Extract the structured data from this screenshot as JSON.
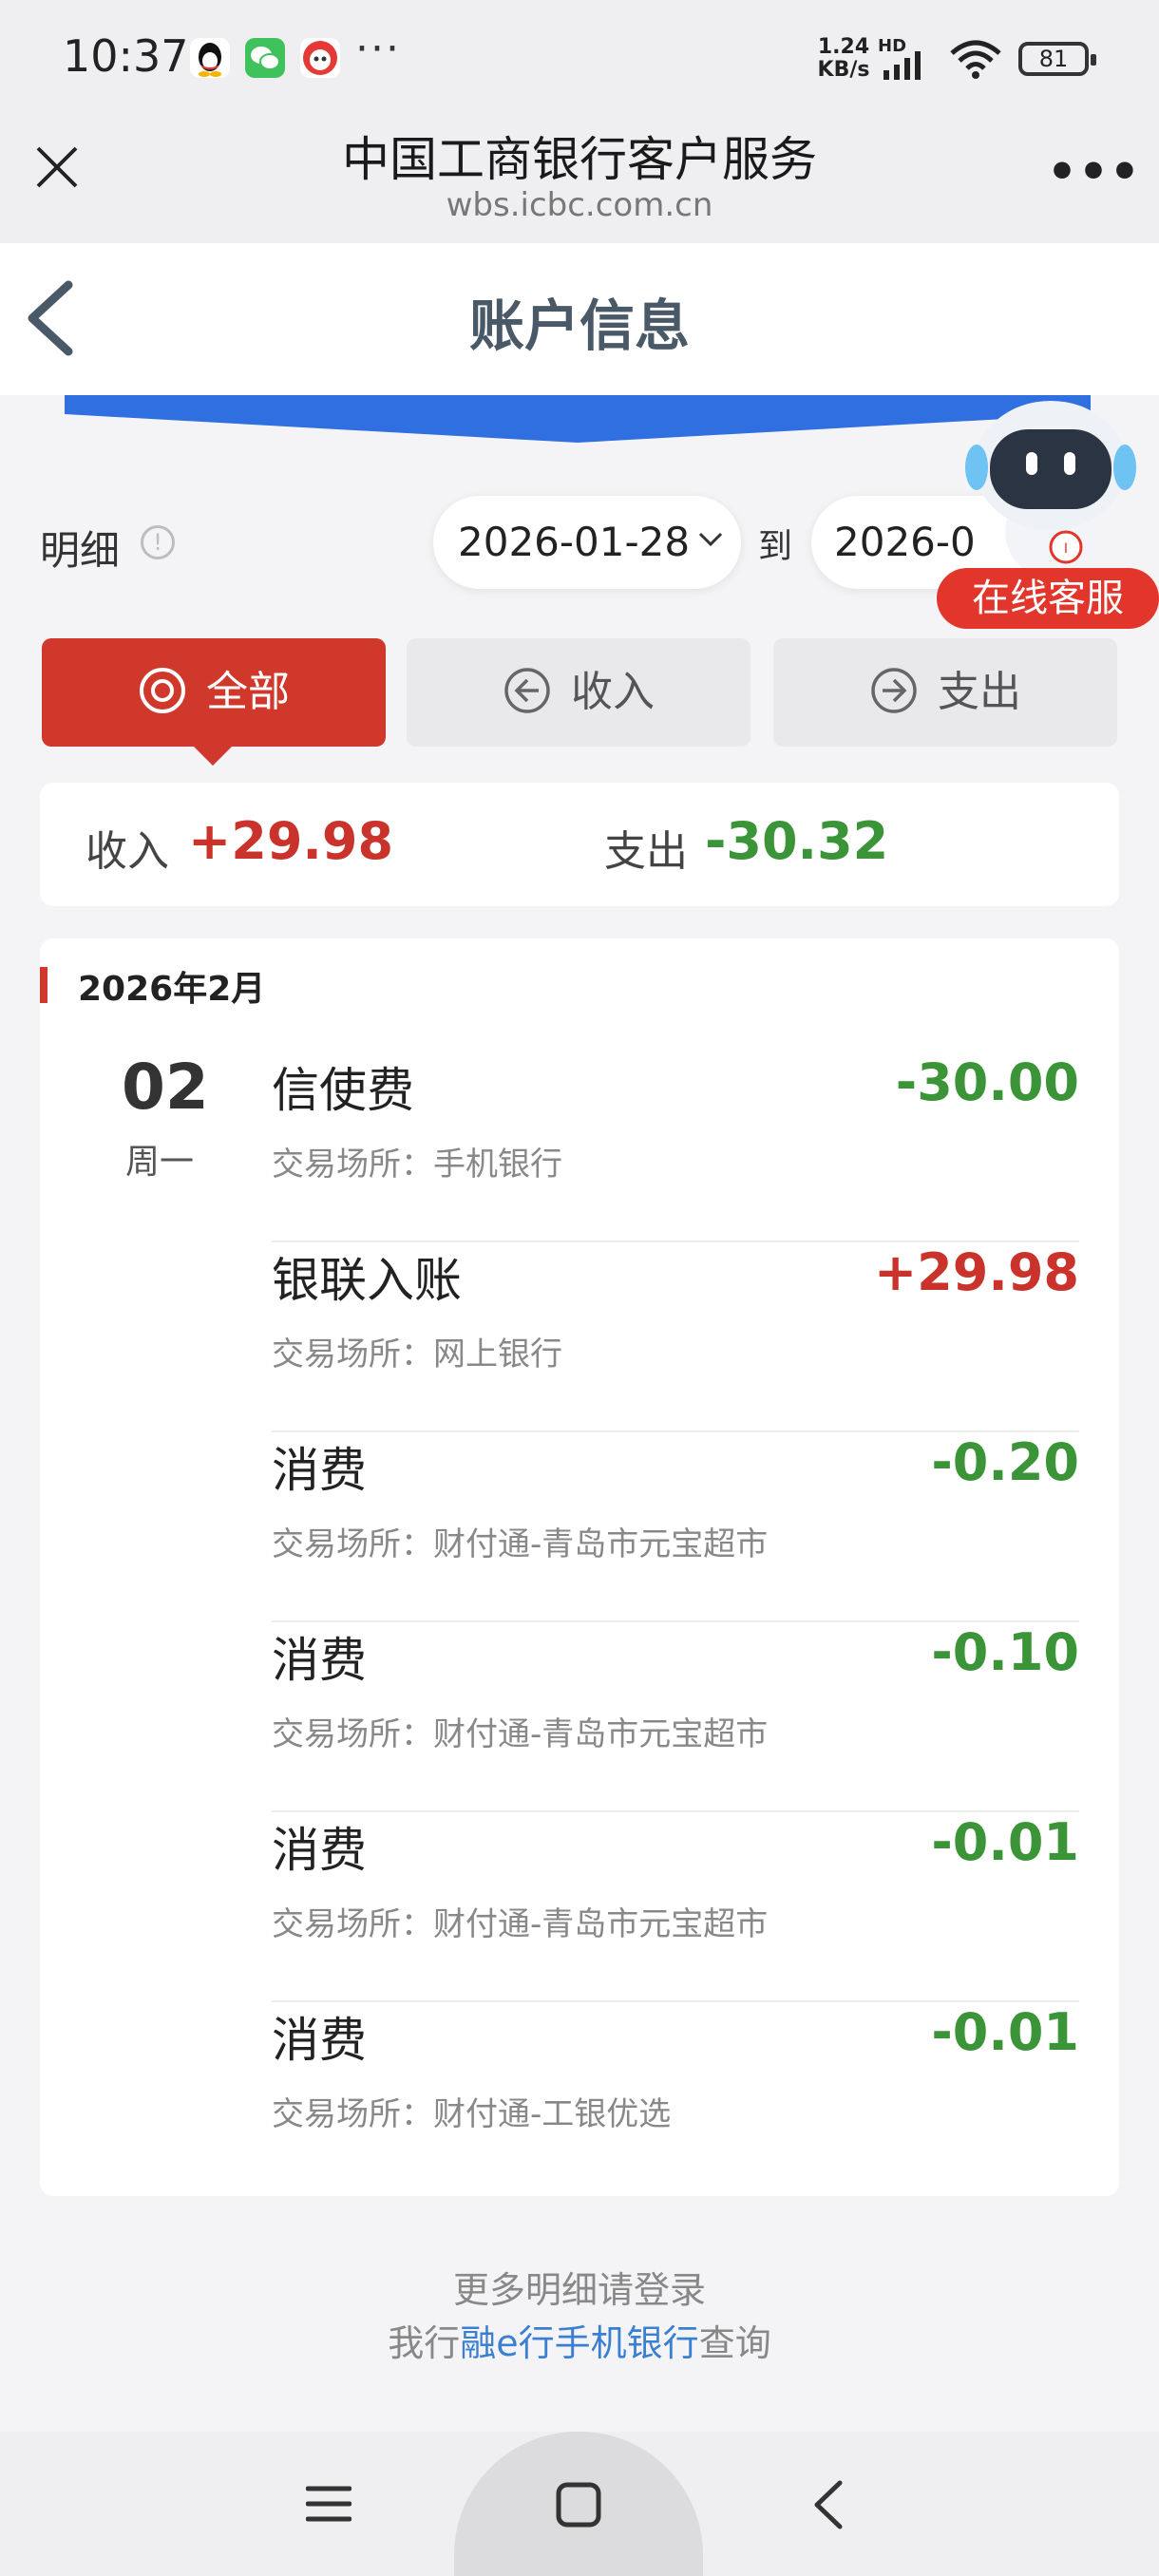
{
  "status_bar": {
    "time": "10:37",
    "overflow": "···",
    "net_speed_value": "1.24",
    "net_speed_unit": "KB/s",
    "hd": "HD",
    "battery": "81",
    "app_icons": [
      "qq-icon",
      "wechat-icon",
      "app-red-icon"
    ]
  },
  "browser": {
    "title": "中国工商银行客户服务",
    "url": "wbs.icbc.com.cn",
    "more": "•••"
  },
  "page": {
    "title": "账户信息"
  },
  "filter": {
    "label": "明细",
    "info": "!",
    "start_date": "2026-01-28",
    "to_label": "到",
    "end_date": "2026-0"
  },
  "assistant": {
    "label": "在线客服"
  },
  "tabs": [
    {
      "label": "全部",
      "icon": "target-icon",
      "active": true
    },
    {
      "label": "收入",
      "icon": "arrow-left-circle-icon",
      "active": false
    },
    {
      "label": "支出",
      "icon": "arrow-right-circle-icon",
      "active": false
    }
  ],
  "summary": {
    "income_label": "收入",
    "income_value": "+29.98",
    "expense_label": "支出",
    "expense_value": "-30.32"
  },
  "transactions": {
    "month": "2026年2月",
    "day": "02",
    "weekday": "周一",
    "items": [
      {
        "title": "信使费",
        "place": "交易场所：手机银行",
        "amount": "-30.00"
      },
      {
        "title": "银联入账",
        "place": "交易场所：网上银行",
        "amount": "+29.98"
      },
      {
        "title": "消费",
        "place": "交易场所：财付通-青岛市元宝超市",
        "amount": "-0.20"
      },
      {
        "title": "消费",
        "place": "交易场所：财付通-青岛市元宝超市",
        "amount": "-0.10"
      },
      {
        "title": "消费",
        "place": "交易场所：财付通-青岛市元宝超市",
        "amount": "-0.01"
      },
      {
        "title": "消费",
        "place": "交易场所：财付通-工银优选",
        "amount": "-0.01"
      }
    ]
  },
  "footer": {
    "line1": "更多明细请登录",
    "line2_prefix": "我行",
    "line2_link": "融e行手机银行",
    "line2_suffix": "查询"
  },
  "colors": {
    "brand_red": "#d0382c",
    "income_red": "#c9332b",
    "expense_green": "#3b9437",
    "link_blue": "#3b7fd0"
  }
}
